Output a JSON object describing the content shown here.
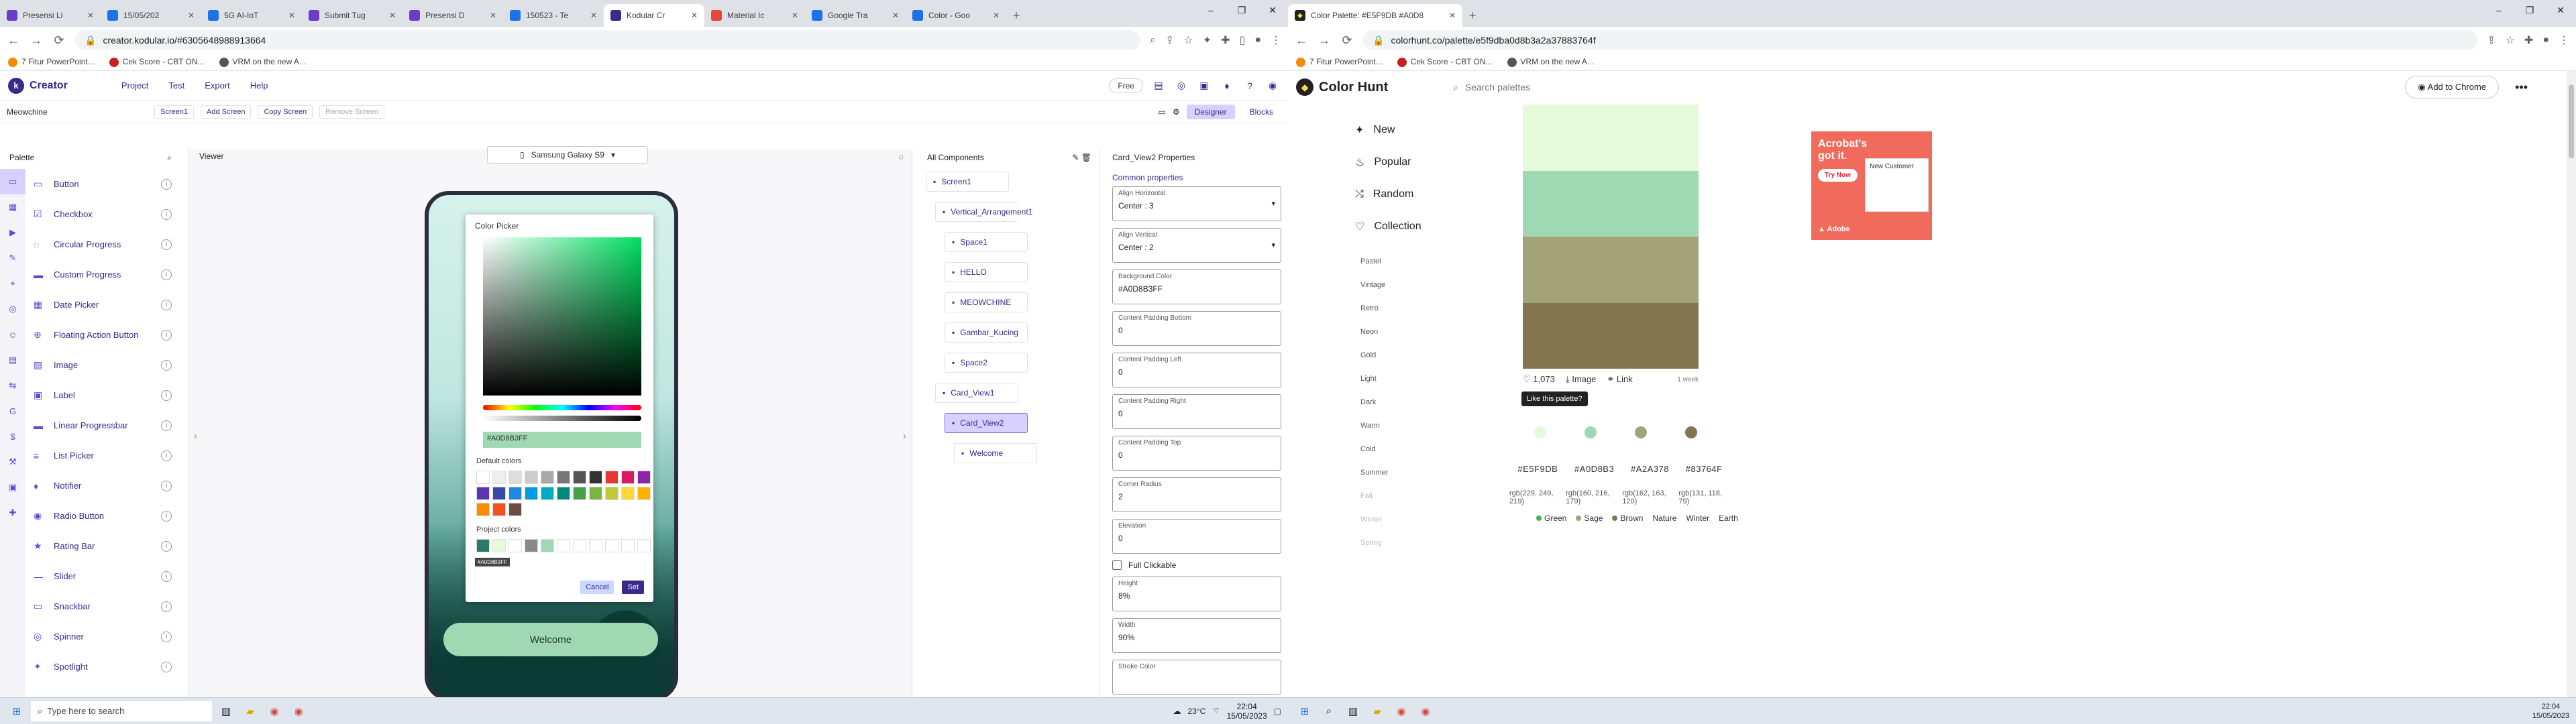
{
  "left": {
    "tabs": [
      {
        "title": "Presensi Li",
        "color": "#6a3cc9"
      },
      {
        "title": "15/05/202",
        "color": "#1a73e8"
      },
      {
        "title": "5G AI-IoT",
        "color": "#1a73e8"
      },
      {
        "title": "Submit Tug",
        "color": "#6a3cc9"
      },
      {
        "title": "Presensi D",
        "color": "#6a3cc9"
      },
      {
        "title": "150523 - Te",
        "color": "#1a73e8"
      },
      {
        "title": "Kodular Cr",
        "color": "#3b2a8c",
        "active": true
      },
      {
        "title": "Material Ic",
        "color": "#e8453c"
      },
      {
        "title": "Google Tra",
        "color": "#1a73e8"
      },
      {
        "title": "Color - Goo",
        "color": "#1a73e8"
      }
    ],
    "url": "creator.kodular.io/#6305648988913664",
    "bookmarks": [
      "7 Fitur PowerPoint...",
      "Cek Score - CBT ON...",
      "VRM on the new A..."
    ],
    "app": {
      "name": "Creator",
      "menu": [
        "Project",
        "Test",
        "Export",
        "Help"
      ],
      "free": "Free"
    },
    "toolbar": {
      "project": "Meowchine",
      "screen": "Screen1",
      "add_screen": "Add Screen",
      "copy_screen": "Copy Screen",
      "remove_screen": "Remove Screen",
      "designer": "Designer",
      "blocks": "Blocks"
    },
    "palette": {
      "title": "Palette",
      "items": [
        "Button",
        "Checkbox",
        "Circular Progress",
        "Custom Progress",
        "Date Picker",
        "Floating Action Button",
        "Image",
        "Label",
        "Linear Progressbar",
        "List Picker",
        "Notifier",
        "Radio Button",
        "Rating Bar",
        "Slider",
        "Snackbar",
        "Spinner",
        "Spotlight"
      ]
    },
    "viewer": {
      "title": "Viewer",
      "device": "Samsung Galaxy S9",
      "welcome": "Welcome"
    },
    "picker": {
      "title": "Color Picker",
      "hex": "#A0D8B3FF",
      "default_colors": "Default colors",
      "project_colors": "Project colors",
      "tooltip": "#A0D8B3FF",
      "cancel": "Cancel",
      "set": "Set"
    },
    "tree": {
      "title": "All Components",
      "nodes": [
        "Screen1",
        "Vertical_Arrangement1",
        "Space1",
        "HELLO",
        "MEOWCHINE",
        "Gambar_Kucing",
        "Space2",
        "Card_View1",
        "Card_View2",
        "Welcome"
      ]
    },
    "props": {
      "title": "Card_View2 Properties",
      "section": "Common properties",
      "fields": [
        {
          "label": "Align Horizontal",
          "value": "Center : 3"
        },
        {
          "label": "Align Vertical",
          "value": "Center : 2"
        },
        {
          "label": "Background Color",
          "value": "#A0D8B3FF"
        },
        {
          "label": "Content Padding Bottom",
          "value": "0"
        },
        {
          "label": "Content Padding Left",
          "value": "0"
        },
        {
          "label": "Content Padding Right",
          "value": "0"
        },
        {
          "label": "Content Padding Top",
          "value": "0"
        },
        {
          "label": "Corner Radius",
          "value": "2"
        },
        {
          "label": "Elevation",
          "value": "0"
        }
      ],
      "full_clickable": "Full Clickable",
      "height_label": "Height",
      "height": "8%",
      "width_label": "Width",
      "width": "90%",
      "stroke": "Stroke Color"
    },
    "taskbar": {
      "search": "Type here to search",
      "temp": "23°C",
      "time": "22:04",
      "date": "15/05/2023"
    }
  },
  "right": {
    "tab": "Color Palette: #E5F9DB #A0D8",
    "url": "colorhunt.co/palette/e5f9dba0d8b3a2a37883764f",
    "bookmarks": [
      "7 Fitur PowerPoint...",
      "Cek Score - CBT ON...",
      "VRM on the new A..."
    ],
    "brand": "Color Hunt",
    "search": "Search palettes",
    "add_chrome": "Add to Chrome",
    "nav": [
      "New",
      "Popular",
      "Random",
      "Collection"
    ],
    "tags": [
      "Pastel",
      "Vintage",
      "Retro",
      "Neon",
      "Gold",
      "Light",
      "Dark",
      "Warm",
      "Cold",
      "Summer",
      "Fall",
      "Winter",
      "Spring"
    ],
    "palette": {
      "colors": [
        "#E5F9DB",
        "#A0D8B3",
        "#A2A378",
        "#83764F"
      ],
      "likes": "1,073",
      "image": "Image",
      "link": "Link",
      "age": "1 week",
      "tooltip": "Like this palette?",
      "hex": [
        "#E5F9DB",
        "#A0D8B3",
        "#A2A378",
        "#83764F"
      ],
      "rgb": [
        "rgb(229, 249, 219)",
        "rgb(160, 216, 179)",
        "rgb(162, 163, 120)",
        "rgb(131, 118, 79)"
      ],
      "tags": [
        {
          "name": "Green",
          "color": "#3fb54a"
        },
        {
          "name": "Sage",
          "color": "#a2a378"
        },
        {
          "name": "Brown",
          "color": "#83764f"
        },
        {
          "name": "Nature",
          "color": ""
        },
        {
          "name": "Winter",
          "color": ""
        },
        {
          "name": "Earth",
          "color": ""
        }
      ]
    },
    "ad": {
      "headline": "Acrobat's got it.",
      "try": "Try Now",
      "inner": "New Customer",
      "brand": "Adobe"
    },
    "taskbar": {
      "time": "22:04",
      "date": "15/05/2023"
    }
  }
}
